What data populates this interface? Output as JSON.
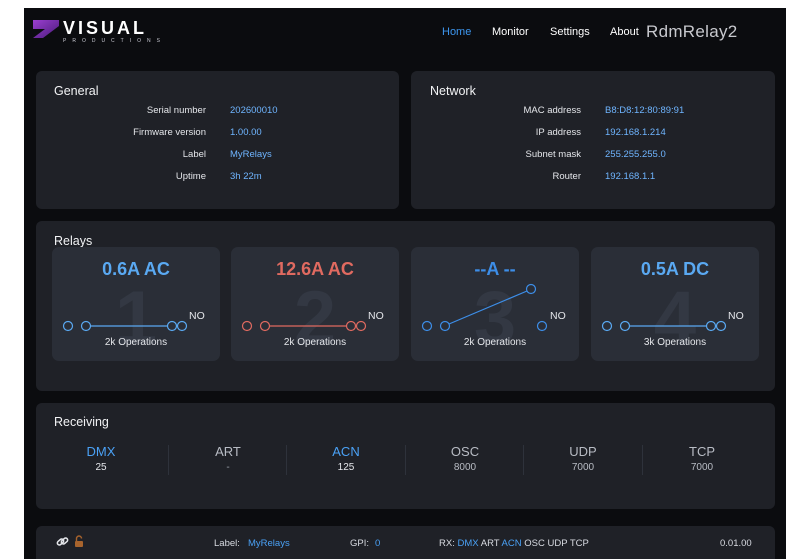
{
  "header": {
    "logo_text": "VISUAL",
    "logo_sub": "PRODUCTIONS",
    "nav": [
      "Home",
      "Monitor",
      "Settings",
      "About"
    ],
    "active_nav": "Home",
    "device_name": "RdmRelay2"
  },
  "general": {
    "title": "General",
    "rows": [
      {
        "label": "Serial number",
        "value": "202600010"
      },
      {
        "label": "Firmware version",
        "value": "1.00.00"
      },
      {
        "label": "Label",
        "value": "MyRelays"
      },
      {
        "label": "Uptime",
        "value": "3h 22m"
      }
    ]
  },
  "network": {
    "title": "Network",
    "rows": [
      {
        "label": "MAC address",
        "value": "B8:D8:12:80:89:91"
      },
      {
        "label": "IP address",
        "value": "192.168.1.214"
      },
      {
        "label": "Subnet mask",
        "value": "255.255.255.0"
      },
      {
        "label": "Router",
        "value": "192.168.1.1"
      }
    ]
  },
  "relays": {
    "title": "Relays",
    "items": [
      {
        "number": "1",
        "current": "0.6A AC",
        "color": "#5aa9f2",
        "state": "closed",
        "no_label": "NO",
        "ops_count": "2k",
        "ops_label": "Operations"
      },
      {
        "number": "2",
        "current": "12.6A AC",
        "color": "#e06a60",
        "state": "closed",
        "no_label": "NO",
        "ops_count": "2k",
        "ops_label": "Operations"
      },
      {
        "number": "3",
        "current": "--A --",
        "color": "#3d8ee8",
        "state": "open",
        "no_label": "NO",
        "ops_count": "2k",
        "ops_label": "Operations"
      },
      {
        "number": "4",
        "current": "0.5A DC",
        "color": "#5aa9f2",
        "state": "closed",
        "no_label": "NO",
        "ops_count": "3k",
        "ops_label": "Operations"
      }
    ]
  },
  "receiving": {
    "title": "Receiving",
    "protocols": [
      {
        "name": "DMX",
        "value": "25",
        "active": true
      },
      {
        "name": "ART",
        "value": "-",
        "active": false
      },
      {
        "name": "ACN",
        "value": "125",
        "active": true
      },
      {
        "name": "OSC",
        "value": "8000",
        "active": false
      },
      {
        "name": "UDP",
        "value": "7000",
        "active": false
      },
      {
        "name": "TCP",
        "value": "7000",
        "active": false
      }
    ]
  },
  "footer": {
    "label_caption": "Label:",
    "label_value": "MyRelays",
    "gpi_caption": "GPI:",
    "gpi_value": "0",
    "rx_caption": "RX:",
    "rx_items": [
      {
        "name": "DMX",
        "active": true
      },
      {
        "name": "ART",
        "active": false
      },
      {
        "name": "ACN",
        "active": true
      },
      {
        "name": "OSC",
        "active": false
      },
      {
        "name": "UDP",
        "active": false
      },
      {
        "name": "TCP",
        "active": false
      }
    ],
    "version": "0.01.00"
  },
  "colors": {
    "accent_blue": "#4aa1f5",
    "warn_red": "#e06a60",
    "panel_bg": "#1f2127",
    "page_bg": "#0b0c0f"
  }
}
